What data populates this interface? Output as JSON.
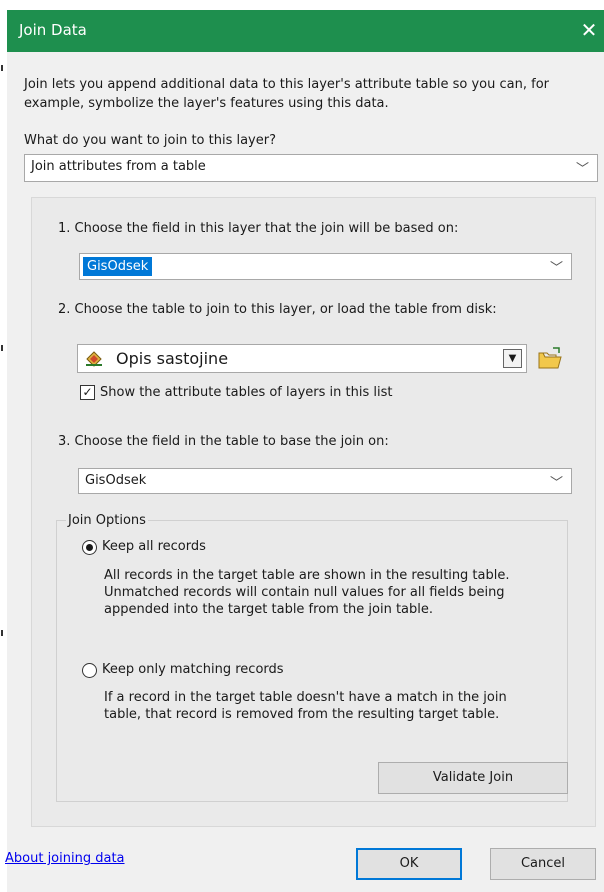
{
  "window": {
    "title": "Join Data",
    "close_glyph": "✕"
  },
  "description": "Join lets you append additional data to this layer's attribute table so you can, for example, symbolize the layer's features using this data.",
  "question": "What do you want to join to this layer?",
  "join_type": {
    "value": "Join attributes from a table"
  },
  "step1": {
    "label": "1.  Choose the field in this layer that the join will be based on:",
    "value": "GisOdsek"
  },
  "step2": {
    "label": "2.  Choose the table to join to this layer, or load the table from disk:",
    "table_name": "Opis sastojine",
    "checkbox_label": "Show the attribute tables of layers in this list",
    "checkbox_checked": true
  },
  "step3": {
    "label": "3.  Choose the field in the table to base the join on:",
    "value": "GisOdsek"
  },
  "join_options": {
    "legend": "Join Options",
    "keep_all": {
      "label": "Keep all records",
      "selected": true,
      "desc_lines": [
        "All records in the target table are shown in the resulting table.",
        "Unmatched records will contain null values for all fields being",
        "appended into the target table from the join table."
      ]
    },
    "keep_matching": {
      "label": "Keep only matching records",
      "selected": false,
      "desc_lines": [
        "If a record in the target table doesn't have a match in the join",
        "table, that record is removed from the resulting target table."
      ]
    }
  },
  "buttons": {
    "validate": "Validate Join",
    "ok": "OK",
    "cancel": "Cancel"
  },
  "footer": {
    "link": "About joining data"
  },
  "icons": {
    "dropdown": "chevron-down-icon",
    "folder": "open-folder-icon",
    "layer": "layer-diamond-icon"
  },
  "colors": {
    "title_bar": "#1e8f4e",
    "selection": "#0078d7",
    "link": "#0000ee"
  }
}
